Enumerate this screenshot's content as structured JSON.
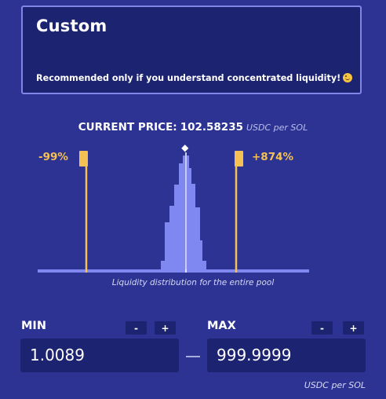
{
  "card": {
    "title": "Custom",
    "note": "Recommended only if you understand concentrated liquidity!",
    "note_emoji": "smiley-face-icon"
  },
  "price": {
    "label": "CURRENT PRICE:",
    "value": "102.58235",
    "unit": "USDC per SOL"
  },
  "range": {
    "lower_pct": "-99%",
    "upper_pct": "+874%"
  },
  "chart_caption": "Liquidity distribution for the entire pool",
  "min": {
    "label": "MIN",
    "decrement": "-",
    "increment": "+",
    "value": "1.0089"
  },
  "max": {
    "label": "MAX",
    "decrement": "-",
    "increment": "+",
    "value": "999.9999"
  },
  "unit_label": "USDC per SOL",
  "colors": {
    "background": "#2c3393",
    "card": "#1c2370",
    "accent_yellow": "#f5c153",
    "bars": "#7f88f0"
  }
}
